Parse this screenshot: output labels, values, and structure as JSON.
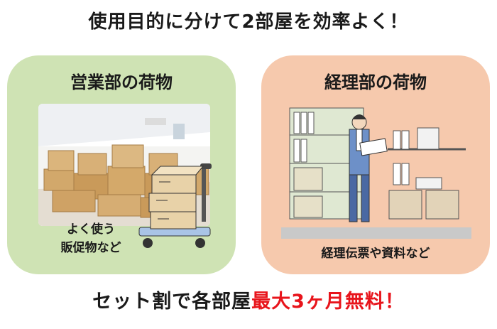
{
  "headline": "使用目的に分けて2部屋を効率よく！",
  "panels": {
    "sales": {
      "title": "営業部の荷物",
      "caption_line1": "よく使う",
      "caption_line2": "販促物など"
    },
    "accounting": {
      "title": "経理部の荷物",
      "caption": "経理伝票や資料など"
    }
  },
  "footer": {
    "lead": "セット割で各部屋",
    "highlight": "最大3ヶ月無料！"
  },
  "colors": {
    "sales_panel": "#cfe3b4",
    "accounting_panel": "#f6c9ad",
    "highlight": "#e8141b"
  }
}
